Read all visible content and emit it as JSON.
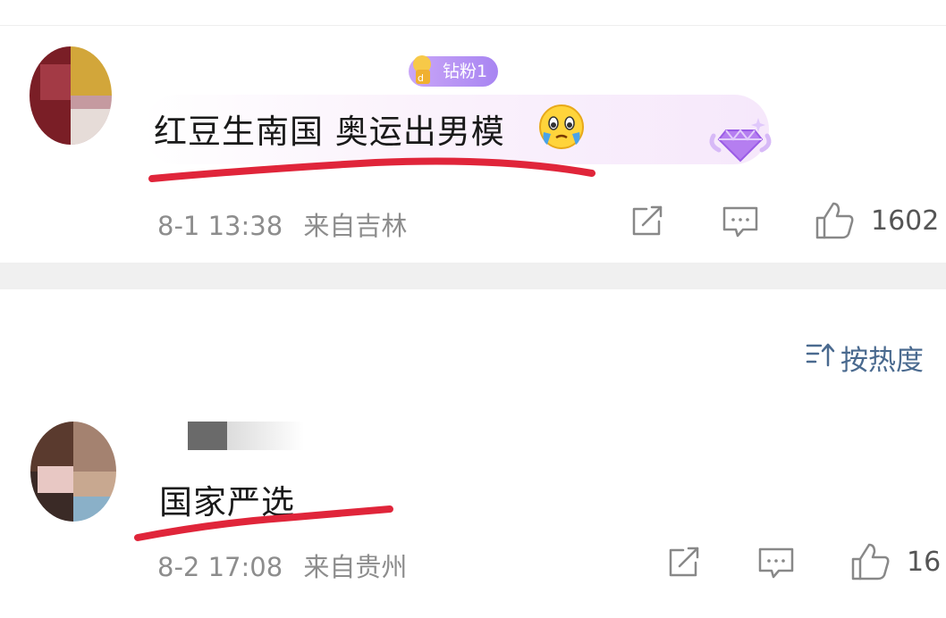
{
  "comments": [
    {
      "badge": "钻粉1",
      "text": "红豆生南国 奥运出男模",
      "date": "8-1 13:38",
      "location": "来自吉林",
      "likes": "1602"
    },
    {
      "text": "国家严选",
      "date": "8-2 17:08",
      "location": "来自贵州",
      "likes": "16"
    }
  ],
  "sort": {
    "label": "按热度"
  },
  "icons": {
    "share": "share-icon",
    "reply": "comment-icon",
    "like": "thumbs-up-icon",
    "sort": "sort-icon",
    "emoji": "teary-face-emoji-icon",
    "badge": "diamond-fan-badge-icon",
    "decoration": "purple-diamond-icon"
  },
  "colors": {
    "underline": "#e0253a",
    "sort_text": "#4a6a8f",
    "badge_bg": "#b996f5"
  }
}
